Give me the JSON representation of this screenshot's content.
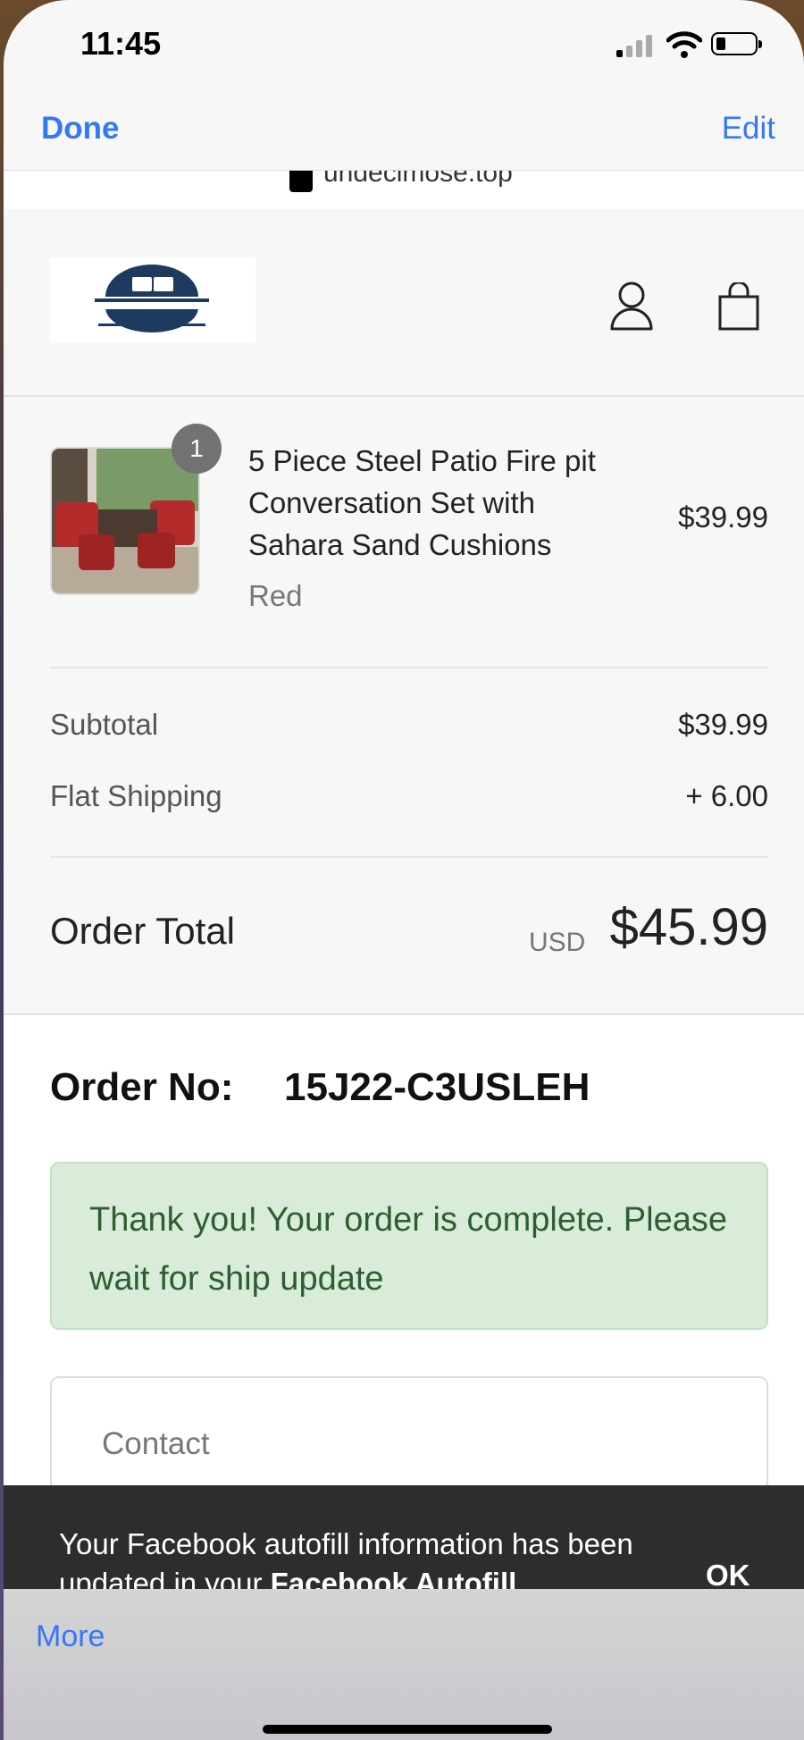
{
  "status_bar": {
    "time": "11:45"
  },
  "nav": {
    "done": "Done",
    "edit": "Edit"
  },
  "url": {
    "domain": "undecimose.top"
  },
  "cart": {
    "qty_badge": "1",
    "item": {
      "title": "5 Piece Steel Patio Fire pit Conversation Set with Sahara Sand Cushions",
      "variant": "Red",
      "price": "$39.99"
    },
    "subtotal_label": "Subtotal",
    "subtotal_value": "$39.99",
    "shipping_label": "Flat Shipping",
    "shipping_value": "+ 6.00",
    "total_label": "Order Total",
    "currency": "USD",
    "total_value": "$45.99"
  },
  "order": {
    "number_label": "Order No:",
    "number": "15J22-C3USLEH",
    "message": "Thank you! Your order is complete. Please wait for ship update",
    "contact_label": "Contact"
  },
  "toast": {
    "text_before": "Your Facebook autofill information has been updated in your ",
    "text_bold": "Facebook Autofill",
    "ok": "OK"
  },
  "bottom_bar": {
    "more": "More"
  },
  "colors": {
    "link_blue": "#3478f6",
    "success_bg": "#d9ecda",
    "success_text": "#2e5e30",
    "toast_bg": "#2d2d2d"
  }
}
